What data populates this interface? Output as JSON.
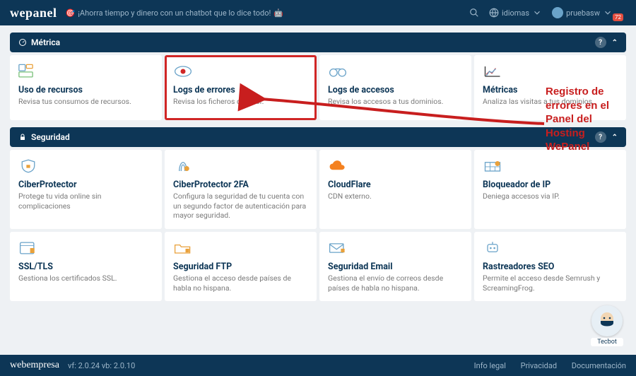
{
  "header": {
    "logo": "wepanel",
    "promo": "¡Ahorra tiempo y dinero con un chatbot que lo dice todo!",
    "lang_label": "idiomas",
    "user_label": "pruebasw",
    "badge_count": "72"
  },
  "sections": {
    "metric": {
      "title": "Métrica",
      "cards": [
        {
          "title": "Uso de recursos",
          "desc": "Revisa tus consumos de recursos."
        },
        {
          "title": "Logs de errores",
          "desc": "Revisa los ficheros de error."
        },
        {
          "title": "Logs de accesos",
          "desc": "Revisa los accesos a tus dominios."
        },
        {
          "title": "Métricas",
          "desc": "Analiza las visitas a tus dominios."
        }
      ]
    },
    "security": {
      "title": "Seguridad",
      "cards": [
        {
          "title": "CiberProtector",
          "desc": "Protege tu vida online sin complicaciones"
        },
        {
          "title": "CiberProtector 2FA",
          "desc": "Configura la seguridad de tu cuenta con un segundo factor de autenticación para mayor seguridad."
        },
        {
          "title": "CloudFlare",
          "desc": "CDN externo."
        },
        {
          "title": "Bloqueador de IP",
          "desc": "Deniega accesos via IP."
        },
        {
          "title": "SSL/TLS",
          "desc": "Gestiona los certificados SSL."
        },
        {
          "title": "Seguridad FTP",
          "desc": "Gestiona el acceso desde países de habla no hispana."
        },
        {
          "title": "Seguridad Email",
          "desc": "Gestiona el envío de correos desde países de habla no hispana."
        },
        {
          "title": "Rastreadores SEO",
          "desc": "Permite el acceso desde Semrush y ScreamingFrog."
        }
      ]
    }
  },
  "annotation": {
    "text": "Registro de errores en el Panel del Hosting WePanel"
  },
  "tecbot": {
    "label": "Tecbot"
  },
  "footer": {
    "brand": "webempresa",
    "version": "vf: 2.0.24 vb: 2.0.10",
    "links": [
      "Info legal",
      "Privacidad",
      "Documentación"
    ]
  }
}
